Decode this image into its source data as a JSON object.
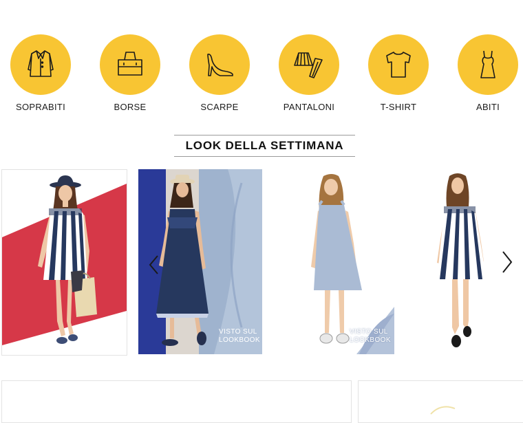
{
  "categories": [
    {
      "label": "SOPRABITI",
      "icon": "coat-icon"
    },
    {
      "label": "BORSE",
      "icon": "bag-icon"
    },
    {
      "label": "SCARPE",
      "icon": "shoe-icon"
    },
    {
      "label": "PANTALONI",
      "icon": "skirt-pants-icon"
    },
    {
      "label": "T-SHIRT",
      "icon": "tshirt-icon"
    },
    {
      "label": "ABITI",
      "icon": "dress-icon"
    }
  ],
  "look": {
    "title": "LOOK DELLA SETTIMANA",
    "cards": [
      {
        "badge": ""
      },
      {
        "badge_line1": "VISTO SUL",
        "badge_line2": "LOOKBOOK"
      },
      {
        "badge_line1": "VISTO SUL",
        "badge_line2": "LOOKBOOK"
      },
      {
        "badge": ""
      }
    ]
  },
  "colors": {
    "accent": "#f8c533",
    "red_stripe": "#d63848",
    "denim": "#26385e",
    "light_blue": "#aebfd6"
  }
}
